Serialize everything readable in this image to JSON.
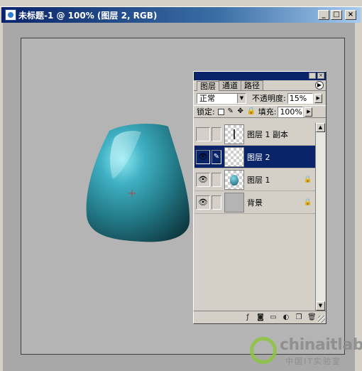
{
  "window": {
    "title": "未标题-1 @ 100% (图层 2, RGB)",
    "controls": {
      "minimize": "_",
      "maximize": "□",
      "close": "×"
    }
  },
  "layers_panel": {
    "tabs": [
      {
        "label": "图层",
        "active": true
      },
      {
        "label": "通道",
        "active": false
      },
      {
        "label": "路径",
        "active": false
      }
    ],
    "blend_mode": "正常",
    "opacity_label": "不透明度:",
    "opacity_value": "15%",
    "lock_label": "锁定:",
    "fill_label": "填充:",
    "fill_value": "100%",
    "layers": [
      {
        "name": "图层 1 副本",
        "visible": false,
        "selected": false,
        "locked": false
      },
      {
        "name": "图层 2",
        "visible": true,
        "selected": true,
        "locked": false
      },
      {
        "name": "图层 1",
        "visible": true,
        "selected": false,
        "locked": true
      },
      {
        "name": "背景",
        "visible": true,
        "selected": false,
        "locked": true
      }
    ]
  },
  "watermark": {
    "brand": "chinaitlab",
    "subtitle": "中国IT实验室"
  },
  "colors": {
    "titlebar": "#0a246a",
    "selection": "#0a246a",
    "canvas": "#b4b4b4",
    "vessel": "#2a8a9a",
    "logo_green": "#8cc63f"
  }
}
